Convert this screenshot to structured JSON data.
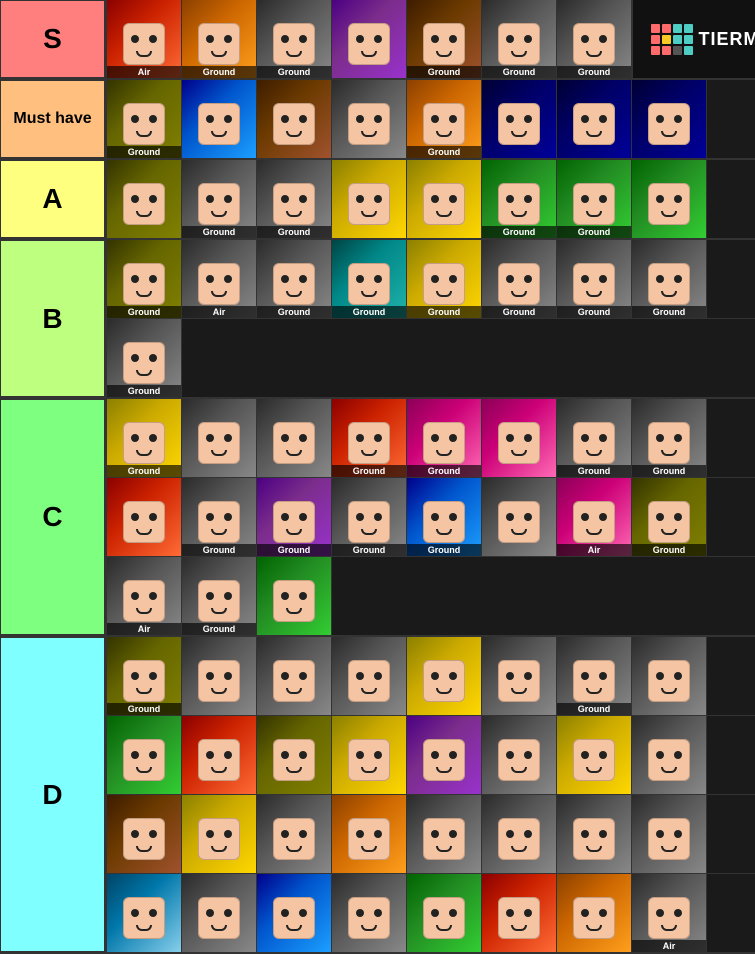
{
  "app": {
    "title": "Tier Maker",
    "logo_text": "TIERMAKER"
  },
  "tiers": [
    {
      "id": "s",
      "label": "S",
      "color": "#ff7f7f",
      "rows": [
        [
          {
            "label": "Air",
            "color": "c-red"
          },
          {
            "label": "Ground",
            "color": "c-orange"
          },
          {
            "label": "Ground",
            "color": "c-gray"
          },
          {
            "label": "",
            "color": "c-purple"
          },
          {
            "label": "Ground",
            "color": "c-brown"
          },
          {
            "label": "Ground",
            "color": "c-gray"
          },
          {
            "label": "Ground",
            "color": "c-gray"
          },
          {
            "label": "",
            "color": "c-navy",
            "logo": true
          }
        ]
      ]
    },
    {
      "id": "musthave",
      "label": "Must have",
      "color": "#ffbf7f",
      "labelSize": "16px",
      "rows": [
        [
          {
            "label": "Ground",
            "color": "c-olive"
          },
          {
            "label": "",
            "color": "c-blue"
          },
          {
            "label": "",
            "color": "c-brown"
          },
          {
            "label": "",
            "color": "c-gray"
          },
          {
            "label": "Ground",
            "color": "c-orange"
          },
          {
            "label": "",
            "color": "c-navy"
          },
          {
            "label": "",
            "color": "c-navy"
          },
          {
            "label": "",
            "color": "c-navy"
          }
        ]
      ]
    },
    {
      "id": "a",
      "label": "A",
      "color": "#ffff7f",
      "rows": [
        [
          {
            "label": "",
            "color": "c-olive"
          },
          {
            "label": "Ground",
            "color": "c-gray"
          },
          {
            "label": "Ground",
            "color": "c-gray"
          },
          {
            "label": "",
            "color": "c-yellow"
          },
          {
            "label": "",
            "color": "c-yellow"
          },
          {
            "label": "Ground",
            "color": "c-green"
          },
          {
            "label": "Ground",
            "color": "c-green"
          },
          {
            "label": "",
            "color": "c-green"
          }
        ]
      ]
    },
    {
      "id": "b",
      "label": "B",
      "color": "#bfff7f",
      "rows": [
        [
          {
            "label": "Ground",
            "color": "c-olive"
          },
          {
            "label": "Air",
            "color": "c-gray"
          },
          {
            "label": "Ground",
            "color": "c-gray"
          },
          {
            "label": "Ground",
            "color": "c-teal"
          },
          {
            "label": "Ground",
            "color": "c-yellow"
          },
          {
            "label": "Ground",
            "color": "c-gray"
          },
          {
            "label": "Ground",
            "color": "c-gray"
          },
          {
            "label": "Ground",
            "color": "c-gray"
          }
        ],
        [
          {
            "label": "Ground",
            "color": "c-gray"
          }
        ]
      ]
    },
    {
      "id": "c",
      "label": "C",
      "color": "#7fff7f",
      "rows": [
        [
          {
            "label": "Ground",
            "color": "c-yellow"
          },
          {
            "label": "",
            "color": "c-gray"
          },
          {
            "label": "",
            "color": "c-gray"
          },
          {
            "label": "Ground",
            "color": "c-red"
          },
          {
            "label": "Ground",
            "color": "c-pink"
          },
          {
            "label": "",
            "color": "c-pink"
          },
          {
            "label": "Ground",
            "color": "c-gray"
          },
          {
            "label": "Ground",
            "color": "c-gray"
          }
        ],
        [
          {
            "label": "",
            "color": "c-red"
          },
          {
            "label": "Ground",
            "color": "c-gray"
          },
          {
            "label": "Ground",
            "color": "c-purple"
          },
          {
            "label": "Ground",
            "color": "c-gray"
          },
          {
            "label": "Ground",
            "color": "c-blue"
          },
          {
            "label": "",
            "color": "c-gray"
          },
          {
            "label": "Air",
            "color": "c-pink"
          },
          {
            "label": "Ground",
            "color": "c-olive"
          }
        ],
        [
          {
            "label": "Air",
            "color": "c-gray"
          },
          {
            "label": "Ground",
            "color": "c-gray"
          },
          {
            "label": "",
            "color": "c-green"
          }
        ]
      ]
    },
    {
      "id": "d",
      "label": "D",
      "color": "#7fffff",
      "rows": [
        [
          {
            "label": "Ground",
            "color": "c-olive"
          },
          {
            "label": "",
            "color": "c-gray"
          },
          {
            "label": "",
            "color": "c-gray"
          },
          {
            "label": "",
            "color": "c-gray"
          },
          {
            "label": "",
            "color": "c-yellow"
          },
          {
            "label": "",
            "color": "c-gray"
          },
          {
            "label": "Ground",
            "color": "c-gray"
          },
          {
            "label": "",
            "color": "c-gray"
          }
        ],
        [
          {
            "label": "",
            "color": "c-green"
          },
          {
            "label": "",
            "color": "c-red"
          },
          {
            "label": "",
            "color": "c-olive"
          },
          {
            "label": "",
            "color": "c-yellow"
          },
          {
            "label": "",
            "color": "c-purple"
          },
          {
            "label": "",
            "color": "c-gray"
          },
          {
            "label": "",
            "color": "c-yellow"
          },
          {
            "label": "",
            "color": "c-gray"
          }
        ],
        [
          {
            "label": "",
            "color": "c-brown"
          },
          {
            "label": "",
            "color": "c-yellow"
          },
          {
            "label": "",
            "color": "c-gray"
          },
          {
            "label": "",
            "color": "c-orange"
          },
          {
            "label": "",
            "color": "c-gray"
          },
          {
            "label": "",
            "color": "c-gray"
          },
          {
            "label": "",
            "color": "c-gray"
          },
          {
            "label": "",
            "color": "c-gray"
          }
        ],
        [
          {
            "label": "",
            "color": "c-sky"
          },
          {
            "label": "",
            "color": "c-gray"
          },
          {
            "label": "",
            "color": "c-blue"
          },
          {
            "label": "",
            "color": "c-gray"
          },
          {
            "label": "",
            "color": "c-green"
          },
          {
            "label": "",
            "color": "c-red"
          },
          {
            "label": "",
            "color": "c-orange"
          },
          {
            "label": "Air",
            "color": "c-gray"
          }
        ]
      ]
    }
  ]
}
